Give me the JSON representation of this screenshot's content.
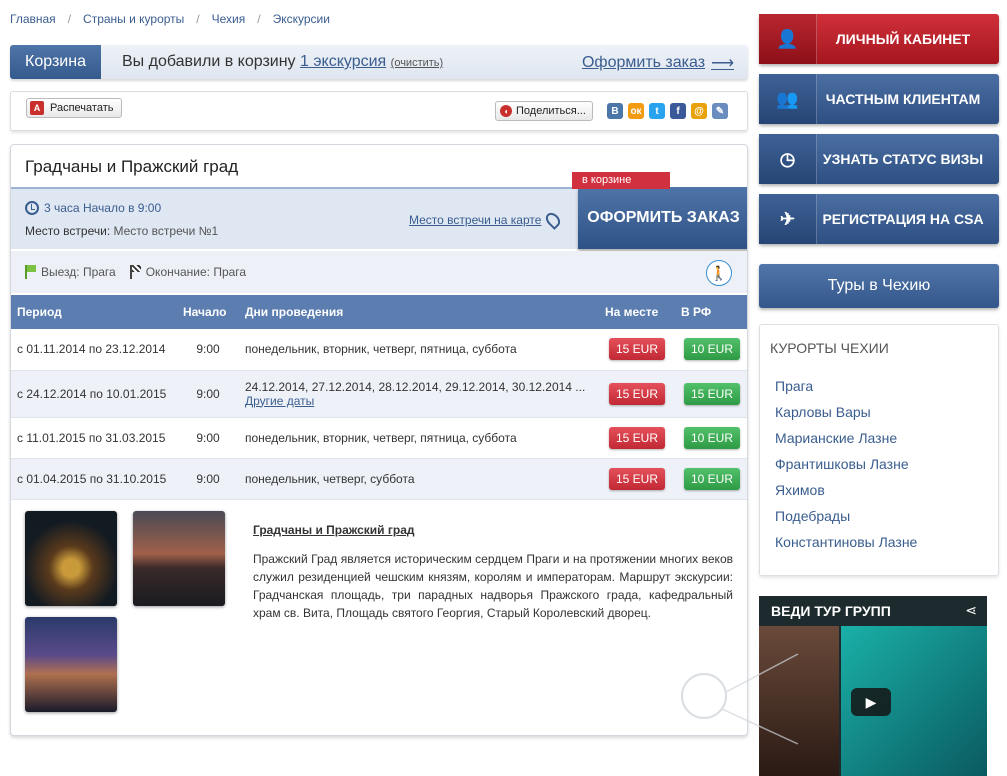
{
  "breadcrumb": [
    "Главная",
    "Страны и курорты",
    "Чехия",
    "Экскурсии"
  ],
  "cart": {
    "tab": "Корзина",
    "msg_prefix": "Вы добавили в корзину",
    "count_link": "1 экскурсия",
    "clear": "(очистить)",
    "checkout": "Оформить заказ",
    "arrow": "⟶"
  },
  "toolbar": {
    "print": "Распечатать",
    "pdf_icon": "A",
    "share": "Поделиться...",
    "social": [
      {
        "icon": "vk-icon",
        "glyph": "B",
        "color": "#4a76a8"
      },
      {
        "icon": "odnoklassniki-icon",
        "glyph": "ок",
        "color": "#f39c12"
      },
      {
        "icon": "twitter-icon",
        "glyph": "t",
        "color": "#2aa3ef"
      },
      {
        "icon": "facebook-icon",
        "glyph": "f",
        "color": "#3b5998"
      },
      {
        "icon": "mailru-icon",
        "glyph": "@",
        "color": "#e8a20c"
      },
      {
        "icon": "livejournal-icon",
        "glyph": "✎",
        "color": "#6b8cbf"
      }
    ]
  },
  "tour": {
    "title": "Градчаны и Пражский град",
    "duration": "3 часа Начало в 9:00",
    "meeting_label": "Место встречи:",
    "meeting_value": "Место встречи №1",
    "map_link": "Место встречи на карте",
    "order_button": "ОФОРМИТЬ ЗАКАЗ",
    "in_cart": "в корзине",
    "departure": "Выезд: Прага",
    "end": "Окончание: Прага",
    "walk_icon": "🚶"
  },
  "table": {
    "headers": [
      "Период",
      "Начало",
      "Дни проведения",
      "На месте",
      "В РФ"
    ],
    "rows": [
      {
        "period": "с 01.11.2014 по 23.12.2014",
        "start": "9:00",
        "days": "понедельник, вторник, четверг, пятница, суббота",
        "more": "",
        "local": "15 EUR",
        "rf": "10 EUR",
        "rf_color": "green"
      },
      {
        "period": "с 24.12.2014 по 10.01.2015",
        "start": "9:00",
        "days": "24.12.2014, 27.12.2014, 28.12.2014, 29.12.2014, 30.12.2014 ...",
        "more": "Другие даты",
        "local": "15 EUR",
        "rf": "15 EUR",
        "rf_color": "green"
      },
      {
        "period": "с 11.01.2015 по 31.03.2015",
        "start": "9:00",
        "days": "понедельник, вторник, четверг, пятница, суббота",
        "more": "",
        "local": "15 EUR",
        "rf": "10 EUR",
        "rf_color": "green"
      },
      {
        "period": "с 01.04.2015 по 31.10.2015",
        "start": "9:00",
        "days": "понедельник, четверг, суббота",
        "more": "",
        "local": "15 EUR",
        "rf": "10 EUR",
        "rf_color": "green"
      }
    ]
  },
  "description": {
    "title": "Градчаны и Пражский град",
    "text": "Пражский Град является историческим сердцем Праги и на протяжении многих веков служил резиденцией чешским князям, королям и императорам. Маршрут экскурсии: Градчанская площадь, три парадных надворья Пражского града, кафедральный храм св. Вита, Площадь святого Георгия, Старый Королевский дворец."
  },
  "sidebar": {
    "buttons": [
      {
        "label": "ЛИЧНЫЙ КАБИНЕТ",
        "icon": "user-icon",
        "glyph": "👤",
        "style": "red"
      },
      {
        "label": "ЧАСТНЫМ КЛИЕНТАМ",
        "icon": "people-icon",
        "glyph": "👥",
        "style": "blue"
      },
      {
        "label": "УЗНАТЬ СТАТУС ВИЗЫ",
        "icon": "clock-icon",
        "glyph": "◷",
        "style": "blue"
      },
      {
        "label": "РЕГИСТРАЦИЯ НА CSA",
        "icon": "csa-icon",
        "glyph": "✈",
        "style": "blue"
      }
    ],
    "tours_button": "Туры в Чехию",
    "resorts_title": "КУРОРТЫ ЧЕХИИ",
    "resorts": [
      "Прага",
      "Карловы Вары",
      "Марианские Лазне",
      "Франтишковы Лазне",
      "Яхимов",
      "Подебрады",
      "Константиновы Лазне"
    ]
  },
  "video": {
    "title": "ВЕДИ ТУР ГРУПП",
    "share_icon": "⋖",
    "play_icon": "▶"
  }
}
